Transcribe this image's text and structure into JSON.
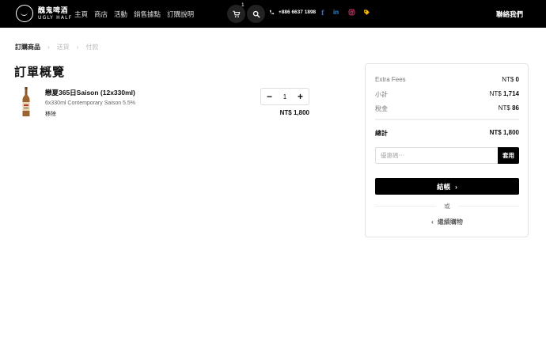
{
  "header": {
    "logo_zh": "醜鬼啤酒",
    "logo_en": "UGLY HALF",
    "nav": [
      "主頁",
      "商店",
      "活動",
      "銷售據點",
      "訂購說明"
    ],
    "cart_count": "1",
    "phone": "+886 6637 1898",
    "social": [
      {
        "icon": "facebook-icon",
        "glyph": "f",
        "color": "#3b6fd6"
      },
      {
        "icon": "linkedin-icon",
        "glyph": "in",
        "color": "#3b82c4"
      },
      {
        "icon": "instagram-icon",
        "color": "#e1306c"
      },
      {
        "icon": "tag-icon",
        "color": "#f4b400"
      }
    ],
    "contact": "聯絡我們"
  },
  "breadcrumb": [
    "訂購商品",
    "送貨",
    "付款"
  ],
  "summary": {
    "title": "訂單概覽",
    "item": {
      "name": "戀夏365日Saison (12x330ml)",
      "description": "6x330ml Contemporary Saison 5.5%",
      "remove_label": "移除",
      "quantity": "1",
      "price": "NT$ 1,800"
    }
  },
  "panel": {
    "extra_fees_label": "Extra Fees",
    "extra_fees_currency": "NT$",
    "extra_fees_value": "0",
    "subtotal_label": "小計",
    "subtotal_currency": "NT$",
    "subtotal_value": "1,714",
    "tax_label": "稅金",
    "tax_currency": "NT$",
    "tax_value": "86",
    "total_label": "總計",
    "total_value": "NT$ 1,800",
    "coupon_placeholder": "優惠碼⋯",
    "coupon_button": "套用",
    "checkout_label": "結帳",
    "or_label": "或",
    "continue_label": "繼續購物"
  },
  "colors": {
    "header_bg": "#000000",
    "accent": "#000000"
  }
}
